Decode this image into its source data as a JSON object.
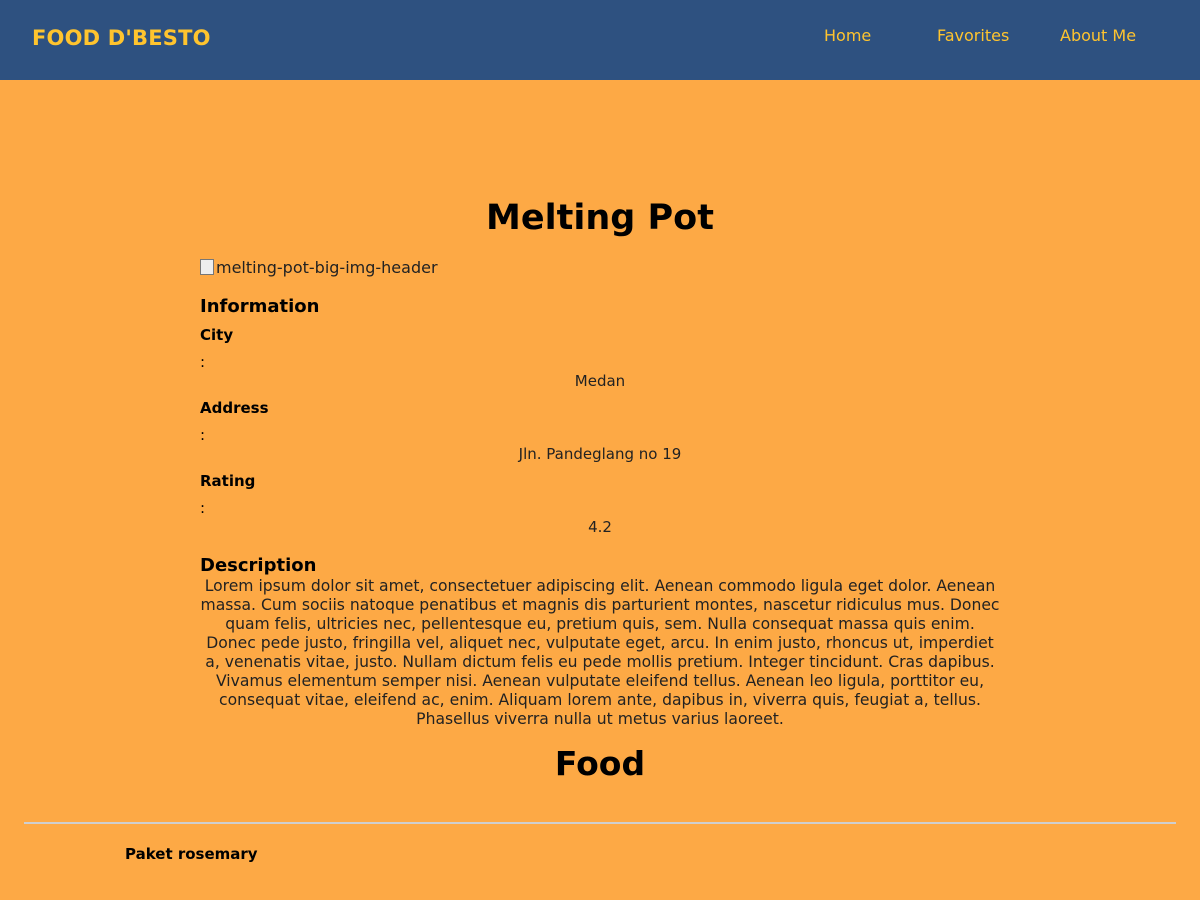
{
  "header": {
    "brand": "FOOD D'BESTO",
    "nav": {
      "home": "Home",
      "favorites": "Favorites",
      "about": "About Me"
    }
  },
  "restaurant": {
    "name": "Melting Pot",
    "image_alt": "melting-pot-big-img-header",
    "info_heading": "Information",
    "city": {
      "label": "City",
      "colon": ":",
      "value": "Medan"
    },
    "address": {
      "label": "Address",
      "colon": ":",
      "value": "Jln. Pandeglang no 19"
    },
    "rating": {
      "label": "Rating",
      "colon": ":",
      "value": "4.2"
    },
    "description_heading": "Description",
    "description": "Lorem ipsum dolor sit amet, consectetuer adipiscing elit. Aenean commodo ligula eget dolor. Aenean massa. Cum sociis natoque penatibus et magnis dis parturient montes, nascetur ridiculus mus. Donec quam felis, ultricies nec, pellentesque eu, pretium quis, sem. Nulla consequat massa quis enim. Donec pede justo, fringilla vel, aliquet nec, vulputate eget, arcu. In enim justo, rhoncus ut, imperdiet a, venenatis vitae, justo. Nullam dictum felis eu pede mollis pretium. Integer tincidunt. Cras dapibus. Vivamus elementum semper nisi. Aenean vulputate eleifend tellus. Aenean leo ligula, porttitor eu, consequat vitae, eleifend ac, enim. Aliquam lorem ante, dapibus in, viverra quis, feugiat a, tellus. Phasellus viverra nulla ut metus varius laoreet."
  },
  "menu": {
    "food_heading": "Food",
    "items": [
      "Paket rosemary"
    ]
  },
  "colors": {
    "header_bg": "#2E5180",
    "page_bg": "#FDA945",
    "accent": "#FFC42E"
  }
}
